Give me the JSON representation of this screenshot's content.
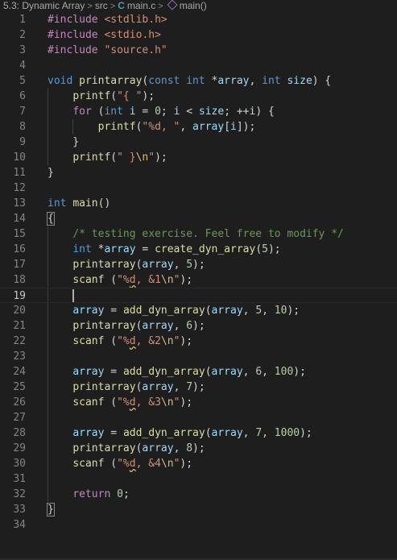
{
  "breadcrumb": {
    "items": [
      "5.3: Dynamic Array",
      "src",
      "main.c",
      "main()"
    ],
    "file_icon": "C"
  },
  "editor": {
    "current_line": 19,
    "lines": [
      {
        "n": 1,
        "tokens": [
          {
            "t": "#include ",
            "c": "k-ctrl"
          },
          {
            "t": "<stdlib.h>",
            "c": "k-str"
          }
        ]
      },
      {
        "n": 2,
        "tokens": [
          {
            "t": "#include ",
            "c": "k-ctrl"
          },
          {
            "t": "<stdio.h>",
            "c": "k-str"
          }
        ]
      },
      {
        "n": 3,
        "tokens": [
          {
            "t": "#include ",
            "c": "k-ctrl"
          },
          {
            "t": "\"source.h\"",
            "c": "k-str"
          }
        ]
      },
      {
        "n": 4,
        "tokens": []
      },
      {
        "n": 5,
        "tokens": [
          {
            "t": "void ",
            "c": "k-type"
          },
          {
            "t": "printarray",
            "c": "k-fn"
          },
          {
            "t": "(",
            "c": "k-pun"
          },
          {
            "t": "const ",
            "c": "k-type"
          },
          {
            "t": "int ",
            "c": "k-type"
          },
          {
            "t": "*",
            "c": "k-pun"
          },
          {
            "t": "array",
            "c": "k-var"
          },
          {
            "t": ", ",
            "c": "k-pun"
          },
          {
            "t": "int ",
            "c": "k-type"
          },
          {
            "t": "size",
            "c": "k-var"
          },
          {
            "t": ") {",
            "c": "k-pun"
          }
        ]
      },
      {
        "n": 6,
        "tokens": [
          {
            "t": "    ",
            "c": "k-pun"
          },
          {
            "t": "printf",
            "c": "k-fn"
          },
          {
            "t": "(",
            "c": "k-pun"
          },
          {
            "t": "\"{ \"",
            "c": "k-str"
          },
          {
            "t": ");",
            "c": "k-pun"
          }
        ]
      },
      {
        "n": 7,
        "tokens": [
          {
            "t": "    ",
            "c": "k-pun"
          },
          {
            "t": "for ",
            "c": "k-ctrl"
          },
          {
            "t": "(",
            "c": "k-pun"
          },
          {
            "t": "int ",
            "c": "k-type"
          },
          {
            "t": "i",
            "c": "k-var"
          },
          {
            "t": " = ",
            "c": "k-pun"
          },
          {
            "t": "0",
            "c": "k-num"
          },
          {
            "t": "; ",
            "c": "k-pun"
          },
          {
            "t": "i",
            "c": "k-var"
          },
          {
            "t": " < ",
            "c": "k-pun"
          },
          {
            "t": "size",
            "c": "k-var"
          },
          {
            "t": "; ++",
            "c": "k-pun"
          },
          {
            "t": "i",
            "c": "k-var"
          },
          {
            "t": ") {",
            "c": "k-pun"
          }
        ]
      },
      {
        "n": 8,
        "tokens": [
          {
            "t": "        ",
            "c": "k-pun"
          },
          {
            "t": "printf",
            "c": "k-fn"
          },
          {
            "t": "(",
            "c": "k-pun"
          },
          {
            "t": "\"%d, \"",
            "c": "k-str"
          },
          {
            "t": ", ",
            "c": "k-pun"
          },
          {
            "t": "array",
            "c": "k-var"
          },
          {
            "t": "[",
            "c": "k-pun"
          },
          {
            "t": "i",
            "c": "k-var"
          },
          {
            "t": "]);",
            "c": "k-pun"
          }
        ]
      },
      {
        "n": 9,
        "tokens": [
          {
            "t": "    }",
            "c": "k-pun"
          }
        ]
      },
      {
        "n": 10,
        "tokens": [
          {
            "t": "    ",
            "c": "k-pun"
          },
          {
            "t": "printf",
            "c": "k-fn"
          },
          {
            "t": "(",
            "c": "k-pun"
          },
          {
            "t": "\" }",
            "c": "k-str"
          },
          {
            "t": "\\n",
            "c": "k-esc"
          },
          {
            "t": "\"",
            "c": "k-str"
          },
          {
            "t": ");",
            "c": "k-pun"
          }
        ]
      },
      {
        "n": 11,
        "tokens": [
          {
            "t": "}",
            "c": "k-pun"
          }
        ]
      },
      {
        "n": 12,
        "tokens": []
      },
      {
        "n": 13,
        "tokens": [
          {
            "t": "int ",
            "c": "k-type"
          },
          {
            "t": "main",
            "c": "k-fn"
          },
          {
            "t": "()",
            "c": "k-pun"
          }
        ]
      },
      {
        "n": 14,
        "tokens": [
          {
            "t": "{",
            "c": "k-pun brace-box"
          }
        ]
      },
      {
        "n": 15,
        "tokens": [
          {
            "t": "    ",
            "c": "k-pun"
          },
          {
            "t": "/* testing exercise. Feel free to modify */",
            "c": "k-com"
          }
        ]
      },
      {
        "n": 16,
        "tokens": [
          {
            "t": "    ",
            "c": "k-pun"
          },
          {
            "t": "int ",
            "c": "k-type"
          },
          {
            "t": "*",
            "c": "k-pun"
          },
          {
            "t": "array",
            "c": "k-var"
          },
          {
            "t": " = ",
            "c": "k-pun"
          },
          {
            "t": "create_dyn_array",
            "c": "k-fn"
          },
          {
            "t": "(",
            "c": "k-pun"
          },
          {
            "t": "5",
            "c": "k-num"
          },
          {
            "t": ");",
            "c": "k-pun"
          }
        ]
      },
      {
        "n": 17,
        "tokens": [
          {
            "t": "    ",
            "c": "k-pun"
          },
          {
            "t": "printarray",
            "c": "k-fn"
          },
          {
            "t": "(",
            "c": "k-pun"
          },
          {
            "t": "array",
            "c": "k-var"
          },
          {
            "t": ", ",
            "c": "k-pun"
          },
          {
            "t": "5",
            "c": "k-num"
          },
          {
            "t": ");",
            "c": "k-pun"
          }
        ]
      },
      {
        "n": 18,
        "tokens": [
          {
            "t": "    ",
            "c": "k-pun"
          },
          {
            "t": "scanf",
            "c": "k-fn"
          },
          {
            "t": " (",
            "c": "k-pun"
          },
          {
            "t": "\"%",
            "c": "k-str"
          },
          {
            "t": "d",
            "c": "k-str squig"
          },
          {
            "t": ", &1",
            "c": "k-str"
          },
          {
            "t": "\\n",
            "c": "k-esc"
          },
          {
            "t": "\"",
            "c": "k-str"
          },
          {
            "t": ");",
            "c": "k-pun"
          }
        ]
      },
      {
        "n": 19,
        "tokens": []
      },
      {
        "n": 20,
        "tokens": [
          {
            "t": "    ",
            "c": "k-pun"
          },
          {
            "t": "array",
            "c": "k-var"
          },
          {
            "t": " = ",
            "c": "k-pun"
          },
          {
            "t": "add_dyn_array",
            "c": "k-fn"
          },
          {
            "t": "(",
            "c": "k-pun"
          },
          {
            "t": "array",
            "c": "k-var"
          },
          {
            "t": ", ",
            "c": "k-pun"
          },
          {
            "t": "5",
            "c": "k-num"
          },
          {
            "t": ", ",
            "c": "k-pun"
          },
          {
            "t": "10",
            "c": "k-num"
          },
          {
            "t": ");",
            "c": "k-pun"
          }
        ]
      },
      {
        "n": 21,
        "tokens": [
          {
            "t": "    ",
            "c": "k-pun"
          },
          {
            "t": "printarray",
            "c": "k-fn"
          },
          {
            "t": "(",
            "c": "k-pun"
          },
          {
            "t": "array",
            "c": "k-var"
          },
          {
            "t": ", ",
            "c": "k-pun"
          },
          {
            "t": "6",
            "c": "k-num"
          },
          {
            "t": ");",
            "c": "k-pun"
          }
        ]
      },
      {
        "n": 22,
        "tokens": [
          {
            "t": "    ",
            "c": "k-pun"
          },
          {
            "t": "scanf",
            "c": "k-fn"
          },
          {
            "t": " (",
            "c": "k-pun"
          },
          {
            "t": "\"%",
            "c": "k-str"
          },
          {
            "t": "d",
            "c": "k-str squig"
          },
          {
            "t": ", &2",
            "c": "k-str"
          },
          {
            "t": "\\n",
            "c": "k-esc"
          },
          {
            "t": "\"",
            "c": "k-str"
          },
          {
            "t": ");",
            "c": "k-pun"
          }
        ]
      },
      {
        "n": 23,
        "tokens": []
      },
      {
        "n": 24,
        "tokens": [
          {
            "t": "    ",
            "c": "k-pun"
          },
          {
            "t": "array",
            "c": "k-var"
          },
          {
            "t": " = ",
            "c": "k-pun"
          },
          {
            "t": "add_dyn_array",
            "c": "k-fn"
          },
          {
            "t": "(",
            "c": "k-pun"
          },
          {
            "t": "array",
            "c": "k-var"
          },
          {
            "t": ", ",
            "c": "k-pun"
          },
          {
            "t": "6",
            "c": "k-num"
          },
          {
            "t": ", ",
            "c": "k-pun"
          },
          {
            "t": "100",
            "c": "k-num"
          },
          {
            "t": ");",
            "c": "k-pun"
          }
        ]
      },
      {
        "n": 25,
        "tokens": [
          {
            "t": "    ",
            "c": "k-pun"
          },
          {
            "t": "printarray",
            "c": "k-fn"
          },
          {
            "t": "(",
            "c": "k-pun"
          },
          {
            "t": "array",
            "c": "k-var"
          },
          {
            "t": ", ",
            "c": "k-pun"
          },
          {
            "t": "7",
            "c": "k-num"
          },
          {
            "t": ");",
            "c": "k-pun"
          }
        ]
      },
      {
        "n": 26,
        "tokens": [
          {
            "t": "    ",
            "c": "k-pun"
          },
          {
            "t": "scanf",
            "c": "k-fn"
          },
          {
            "t": " (",
            "c": "k-pun"
          },
          {
            "t": "\"%",
            "c": "k-str"
          },
          {
            "t": "d",
            "c": "k-str squig"
          },
          {
            "t": ", &3",
            "c": "k-str"
          },
          {
            "t": "\\n",
            "c": "k-esc"
          },
          {
            "t": "\"",
            "c": "k-str"
          },
          {
            "t": ");",
            "c": "k-pun"
          }
        ]
      },
      {
        "n": 27,
        "tokens": []
      },
      {
        "n": 28,
        "tokens": [
          {
            "t": "    ",
            "c": "k-pun"
          },
          {
            "t": "array",
            "c": "k-var"
          },
          {
            "t": " = ",
            "c": "k-pun"
          },
          {
            "t": "add_dyn_array",
            "c": "k-fn"
          },
          {
            "t": "(",
            "c": "k-pun"
          },
          {
            "t": "array",
            "c": "k-var"
          },
          {
            "t": ", ",
            "c": "k-pun"
          },
          {
            "t": "7",
            "c": "k-num"
          },
          {
            "t": ", ",
            "c": "k-pun"
          },
          {
            "t": "1000",
            "c": "k-num"
          },
          {
            "t": ");",
            "c": "k-pun"
          }
        ]
      },
      {
        "n": 29,
        "tokens": [
          {
            "t": "    ",
            "c": "k-pun"
          },
          {
            "t": "printarray",
            "c": "k-fn"
          },
          {
            "t": "(",
            "c": "k-pun"
          },
          {
            "t": "array",
            "c": "k-var"
          },
          {
            "t": ", ",
            "c": "k-pun"
          },
          {
            "t": "8",
            "c": "k-num"
          },
          {
            "t": ");",
            "c": "k-pun"
          }
        ]
      },
      {
        "n": 30,
        "tokens": [
          {
            "t": "    ",
            "c": "k-pun"
          },
          {
            "t": "scanf",
            "c": "k-fn"
          },
          {
            "t": " (",
            "c": "k-pun"
          },
          {
            "t": "\"%",
            "c": "k-str"
          },
          {
            "t": "d",
            "c": "k-str squig"
          },
          {
            "t": ", &4",
            "c": "k-str"
          },
          {
            "t": "\\n",
            "c": "k-esc"
          },
          {
            "t": "\"",
            "c": "k-str"
          },
          {
            "t": ");",
            "c": "k-pun"
          }
        ]
      },
      {
        "n": 31,
        "tokens": []
      },
      {
        "n": 32,
        "tokens": [
          {
            "t": "    ",
            "c": "k-pun"
          },
          {
            "t": "return ",
            "c": "k-ctrl"
          },
          {
            "t": "0",
            "c": "k-num"
          },
          {
            "t": ";",
            "c": "k-pun"
          }
        ]
      },
      {
        "n": 33,
        "tokens": [
          {
            "t": "}",
            "c": "k-pun brace-box"
          }
        ]
      },
      {
        "n": 34,
        "tokens": []
      }
    ]
  }
}
